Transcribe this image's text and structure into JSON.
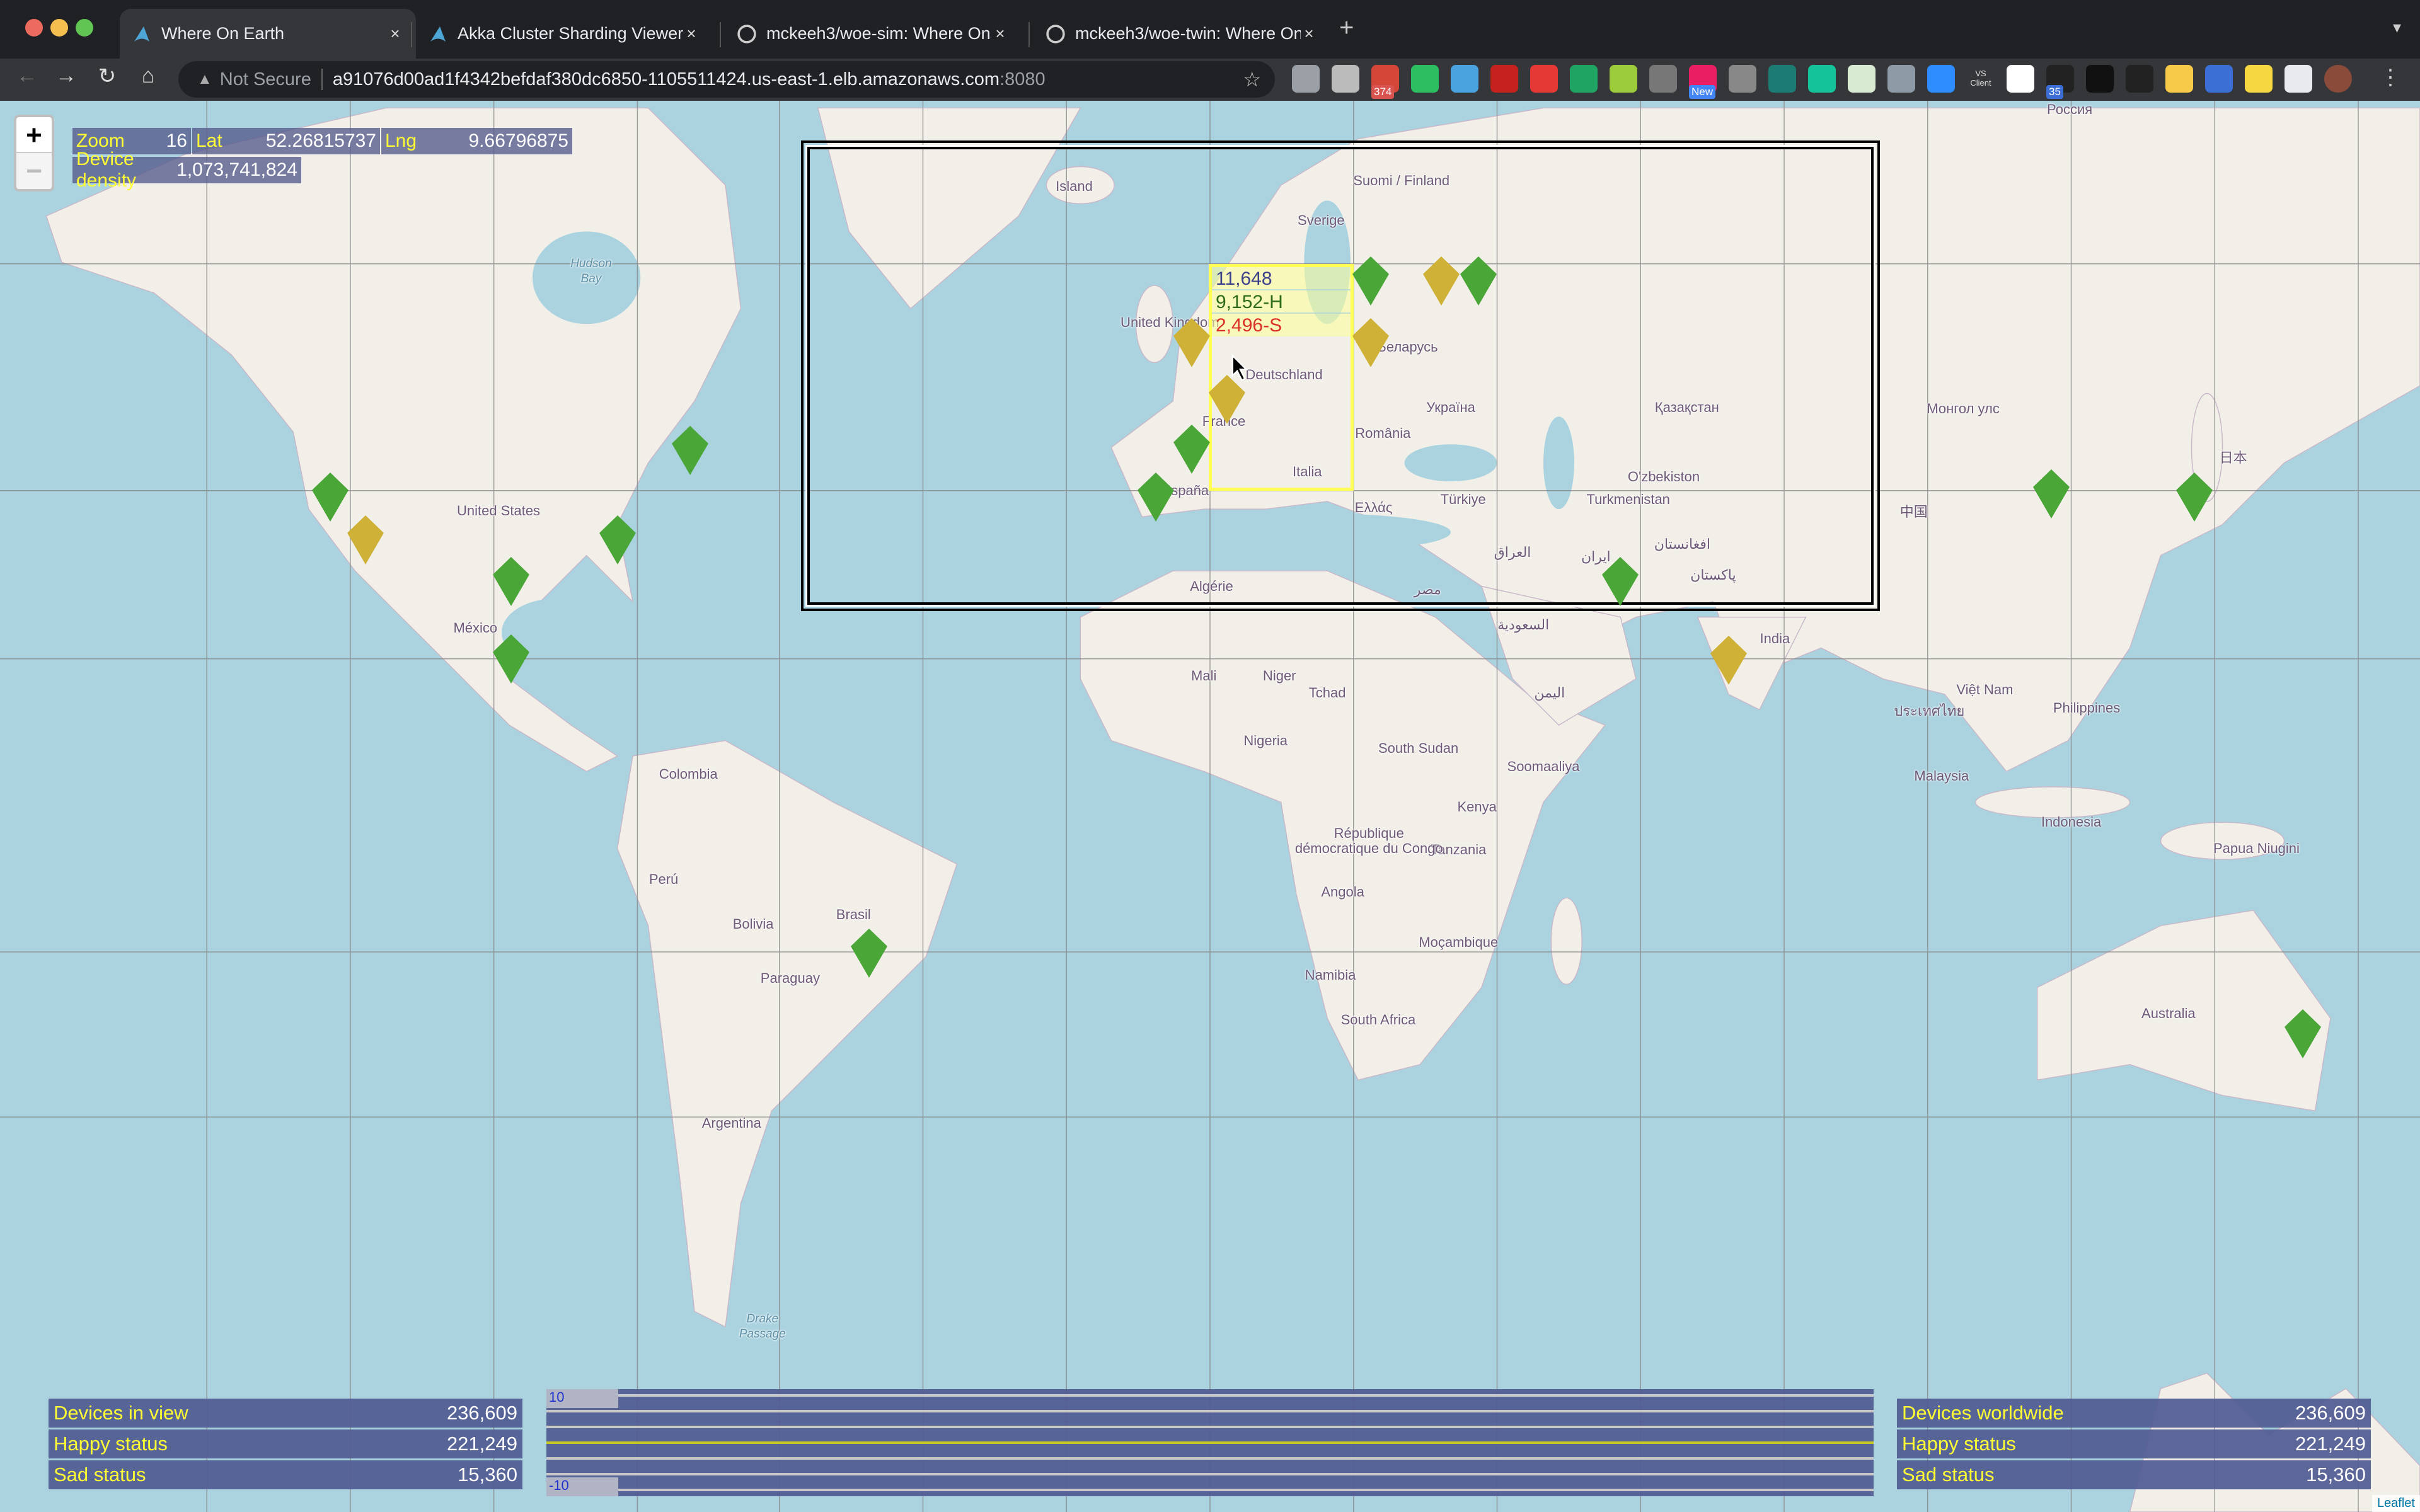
{
  "browser": {
    "tabs": [
      {
        "title": "Where On Earth",
        "icon": "akka-icon",
        "active": true
      },
      {
        "title": "Akka Cluster Sharding Viewer",
        "icon": "akka-icon",
        "active": false
      },
      {
        "title": "mckeeh3/woe-sim: Where On Earth",
        "icon": "github-icon",
        "active": false
      },
      {
        "title": "mckeeh3/woe-twin: Where On Earth",
        "icon": "github-icon",
        "active": false
      }
    ],
    "close_label": "×",
    "new_tab_label": "+",
    "security_label": "Not Secure",
    "url_host": "a91076d00ad1f4342befdaf380dc6850-1105511424.us-east-1.elb.amazonaws.com",
    "url_port": ":8080",
    "extensions": [
      {
        "name": "circle-extension",
        "color": "#9aa0a6"
      },
      {
        "name": "gear-extension",
        "color": "#bbbbbb"
      },
      {
        "name": "gmail-extension",
        "color": "#d44638",
        "badge": "374",
        "badge_color": "#d9534f"
      },
      {
        "name": "evernote-extension",
        "color": "#2dbe60"
      },
      {
        "name": "eyedropper-extension",
        "color": "#4aa3df"
      },
      {
        "name": "mail-extension",
        "color": "#c5221f"
      },
      {
        "name": "adblock-extension",
        "color": "#e53935"
      },
      {
        "name": "drive-extension",
        "color": "#1fa463"
      },
      {
        "name": "green-extension",
        "color": "#9ccc3c"
      },
      {
        "name": "ring-extension",
        "color": "#777777"
      },
      {
        "name": "colorful-extension",
        "color": "#e91e63",
        "badge": "New",
        "badge_color": "#4285f4"
      },
      {
        "name": "chain-extension",
        "color": "#888888"
      },
      {
        "name": "s-extension",
        "color": "#1c7c74"
      },
      {
        "name": "grammarly-extension",
        "color": "#15c39a"
      },
      {
        "name": "sheet-extension",
        "color": "#d9ead3"
      },
      {
        "name": "rocket-extension",
        "color": "#8e9aa5"
      },
      {
        "name": "zoom-extension",
        "color": "#2d8cff"
      },
      {
        "name": "vs-client-extension",
        "color": "#35363a",
        "label": "VS Client"
      },
      {
        "name": "cloud-extension",
        "color": "#ffffff"
      },
      {
        "name": "tally-extension",
        "color": "#222222",
        "badge": "35",
        "badge_color": "#3b6fd6"
      },
      {
        "name": "dark-extension",
        "color": "#111111"
      },
      {
        "name": "circle-dark-extension",
        "color": "#222222"
      },
      {
        "name": "dots-extension",
        "color": "#f7c948"
      },
      {
        "name": "react-extension",
        "color": "#3b6fd6"
      },
      {
        "name": "broom-extension",
        "color": "#f5d742"
      },
      {
        "name": "puzzle-extension",
        "color": "#e8eaed"
      },
      {
        "name": "profile-avatar",
        "color": "#8a4b3a"
      }
    ]
  },
  "map": {
    "zoom_in_label": "+",
    "zoom_out_label": "−",
    "info": {
      "zoom_label": "Zoom",
      "zoom_value": "16",
      "lat_label": "Lat",
      "lat_value": "52.26815737",
      "lng_label": "Lng",
      "lng_value": "9.66796875",
      "density_label": "Device density",
      "density_value": "1,073,741,824"
    },
    "selection": {
      "total": "11,648",
      "happy": "9,152-H",
      "sad": "2,496-S",
      "total_color": "#3c3f8a",
      "happy_color": "#2e6b1a",
      "sad_color": "#d93025"
    },
    "labels": [
      "Island",
      "Suomi / Finland",
      "Sverige",
      "United Kingdom",
      "Deutschland",
      "Беларусь",
      "Україна",
      "France",
      "România",
      "Italia",
      "España",
      "Türkiye",
      "Ελλάς",
      "Қазақстан",
      "O'zbekiston",
      "Turkmenistan",
      "Россия",
      "Монгол улс",
      "日本",
      "中国",
      "Algérie",
      "Hudson Bay",
      "United States",
      "México",
      "Mali",
      "Niger",
      "Tchad",
      "Nigeria",
      "South Sudan",
      "Soomaaliya",
      "Kenya",
      "Tanzania",
      "République démocratique du Congo",
      "Angola",
      "Namibia",
      "South Africa",
      "Moçambique",
      "India",
      "Việt Nam",
      "Philippines",
      "Malaysia",
      "Indonesia",
      "Papua Niugini",
      "Australia",
      "Colombia",
      "Perú",
      "Bolivia",
      "Brasil",
      "Paraguay",
      "Argentina",
      "Drake Passage",
      "السعودية",
      "ایران",
      "افغانستان",
      "پاکستان",
      "اليمن",
      "مصر",
      "العراق",
      "ประเทศไทย"
    ],
    "marker_colors": {
      "happy": "#4aa637",
      "mixed": "#ceb136"
    },
    "markers": [
      "happy",
      "mixed",
      "happy",
      "happy",
      "mixed",
      "happy",
      "happy",
      "happy",
      "happy",
      "happy",
      "happy",
      "mixed",
      "mixed",
      "happy",
      "happy",
      "happy",
      "mixed",
      "happy",
      "mixed",
      "happy"
    ],
    "attribution": "Leaflet"
  },
  "stats_view": [
    {
      "label": "Devices in view",
      "value": "236,609"
    },
    {
      "label": "Happy status",
      "value": "221,249"
    },
    {
      "label": "Sad status",
      "value": "15,360"
    }
  ],
  "stats_world": [
    {
      "label": "Devices worldwide",
      "value": "236,609"
    },
    {
      "label": "Happy status",
      "value": "221,249"
    },
    {
      "label": "Sad status",
      "value": "15,360"
    }
  ],
  "chart_data": {
    "type": "line",
    "ylim": [
      -10,
      10
    ],
    "ytick_labels": [
      "10",
      "-10"
    ],
    "grid": true,
    "series": [
      {
        "values": [
          0,
          0
        ],
        "color": "#c8c820"
      }
    ]
  }
}
